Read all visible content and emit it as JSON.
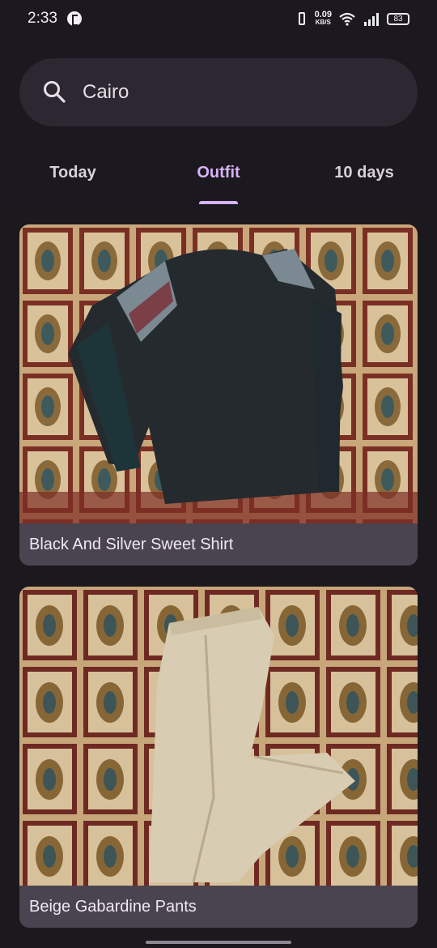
{
  "status_bar": {
    "time": "2:33",
    "net_speed_value": "0.09",
    "net_speed_unit": "KB/S",
    "battery": "83"
  },
  "search": {
    "value": "Cairo",
    "icon": "search-icon"
  },
  "tabs": [
    {
      "label": "Today",
      "active": false
    },
    {
      "label": "Outfit",
      "active": true
    },
    {
      "label": "10 days",
      "active": false
    }
  ],
  "outfits": [
    {
      "name": "Black And Silver Sweet Shirt"
    },
    {
      "name": "Beige Gabardine Pants"
    }
  ],
  "colors": {
    "accent": "#d7b3f5",
    "background": "#1b181e",
    "card": "#4a4350"
  }
}
